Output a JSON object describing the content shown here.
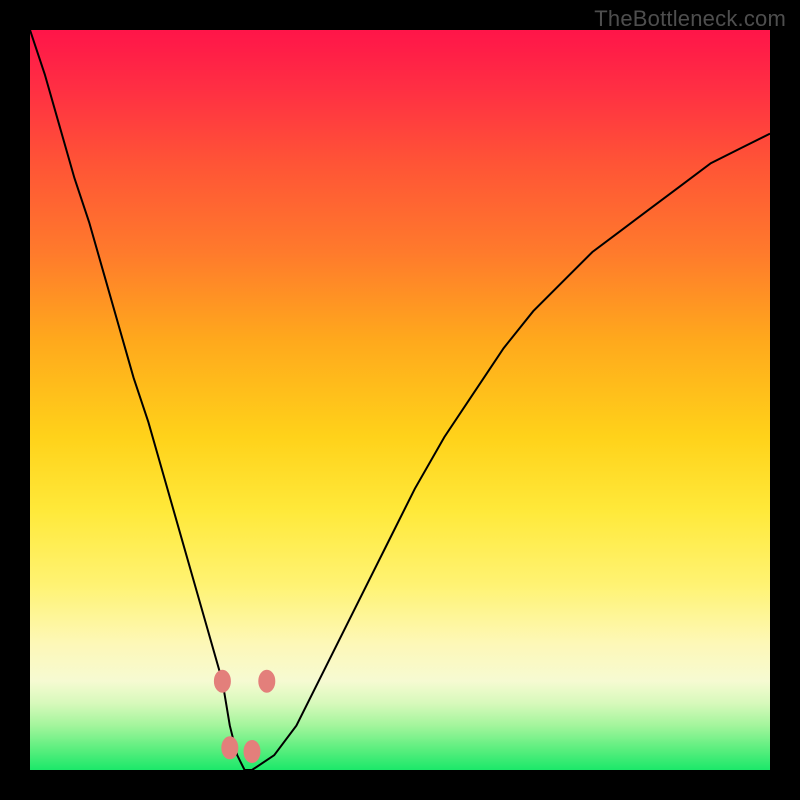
{
  "watermark": "TheBottleneck.com",
  "colors": {
    "frame_bg": "#000000",
    "watermark_text": "#4e4e4e",
    "curve_stroke": "#000000",
    "marker_fill": "#e37f7b",
    "gradient": [
      {
        "pos": 0.0,
        "hex": "#ff1549"
      },
      {
        "pos": 0.3,
        "hex": "#ff7a2c"
      },
      {
        "pos": 0.55,
        "hex": "#ffd21a"
      },
      {
        "pos": 0.83,
        "hex": "#fdf8b8"
      },
      {
        "pos": 0.94,
        "hex": "#a3f59c"
      },
      {
        "pos": 1.0,
        "hex": "#1be86a"
      }
    ]
  },
  "chart_data": {
    "type": "line",
    "title": "",
    "xlabel": "",
    "ylabel": "",
    "xlim": [
      0,
      100
    ],
    "ylim": [
      0,
      100
    ],
    "x": [
      0,
      2,
      4,
      6,
      8,
      10,
      12,
      14,
      16,
      18,
      20,
      22,
      24,
      26,
      27,
      28,
      29,
      30,
      33,
      36,
      40,
      44,
      48,
      52,
      56,
      60,
      64,
      68,
      72,
      76,
      80,
      84,
      88,
      92,
      96,
      100
    ],
    "series": [
      {
        "name": "bottleneck-curve",
        "values": [
          100,
          94,
          87,
          80,
          74,
          67,
          60,
          53,
          47,
          40,
          33,
          26,
          19,
          12,
          6,
          2,
          0,
          0,
          2,
          6,
          14,
          22,
          30,
          38,
          45,
          51,
          57,
          62,
          66,
          70,
          73,
          76,
          79,
          82,
          84,
          86
        ]
      }
    ],
    "markers": [
      {
        "x": 26,
        "y": 12
      },
      {
        "x": 27,
        "y": 3
      },
      {
        "x": 30,
        "y": 2.5
      },
      {
        "x": 32,
        "y": 12
      }
    ],
    "notes": "V-shaped curve; minimum (valley) around x≈28–29 where y≈0. Background heatmap gradient runs top (red=high) to bottom (green=low). Salmon markers sit around the valley."
  }
}
